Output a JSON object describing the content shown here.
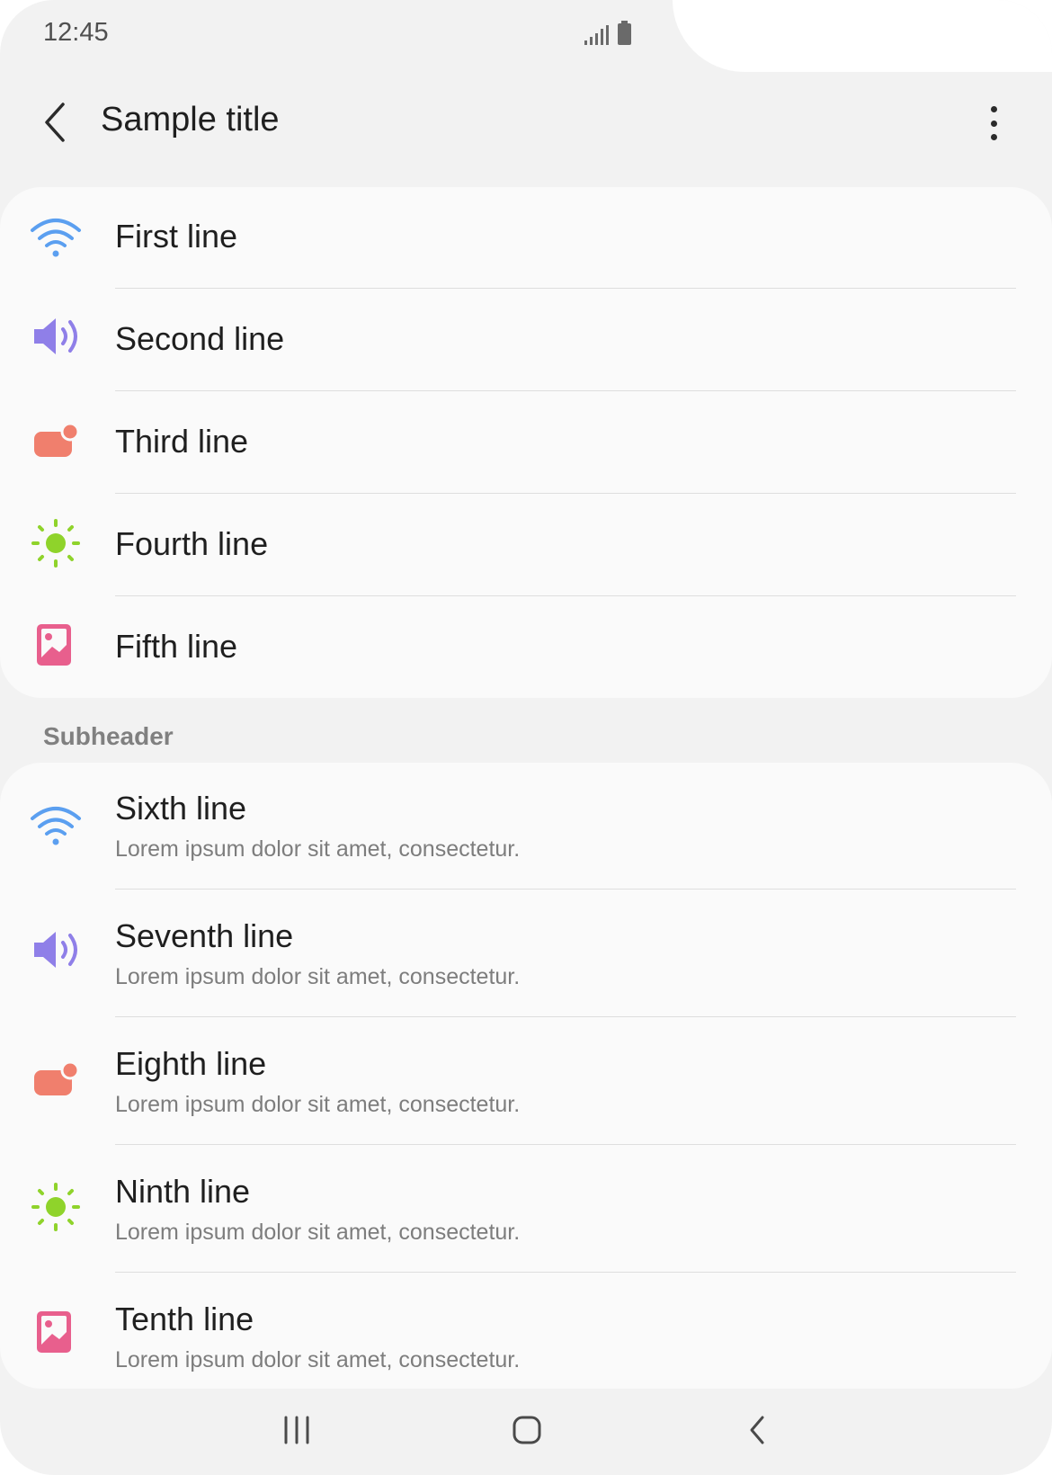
{
  "status_bar": {
    "time": "12:45"
  },
  "app_bar": {
    "title": "Sample title"
  },
  "list1": [
    {
      "label": "First line",
      "icon": "wifi-icon",
      "color": "#5b9ff0"
    },
    {
      "label": "Second line",
      "icon": "volume-icon",
      "color": "#8f7fe8"
    },
    {
      "label": "Third line",
      "icon": "notification-icon",
      "color": "#f07f6d"
    },
    {
      "label": "Fourth line",
      "icon": "brightness-icon",
      "color": "#8fd32b"
    },
    {
      "label": "Fifth line",
      "icon": "image-icon",
      "color": "#e85f8d"
    }
  ],
  "subheader": "Subheader",
  "list2": [
    {
      "label": "Sixth line",
      "sub": "Lorem ipsum dolor sit amet, consectetur.",
      "icon": "wifi-icon",
      "color": "#5b9ff0"
    },
    {
      "label": "Seventh line",
      "sub": "Lorem ipsum dolor sit amet, consectetur.",
      "icon": "volume-icon",
      "color": "#8f7fe8"
    },
    {
      "label": "Eighth line",
      "sub": "Lorem ipsum dolor sit amet, consectetur.",
      "icon": "notification-icon",
      "color": "#f07f6d"
    },
    {
      "label": "Ninth line",
      "sub": "Lorem ipsum dolor sit amet, consectetur.",
      "icon": "brightness-icon",
      "color": "#8fd32b"
    },
    {
      "label": "Tenth line",
      "sub": "Lorem ipsum dolor sit amet, consectetur.",
      "icon": "image-icon",
      "color": "#e85f8d"
    }
  ],
  "nav_bar": {
    "buttons": [
      "recent-apps-icon",
      "home-icon",
      "back-icon"
    ]
  }
}
